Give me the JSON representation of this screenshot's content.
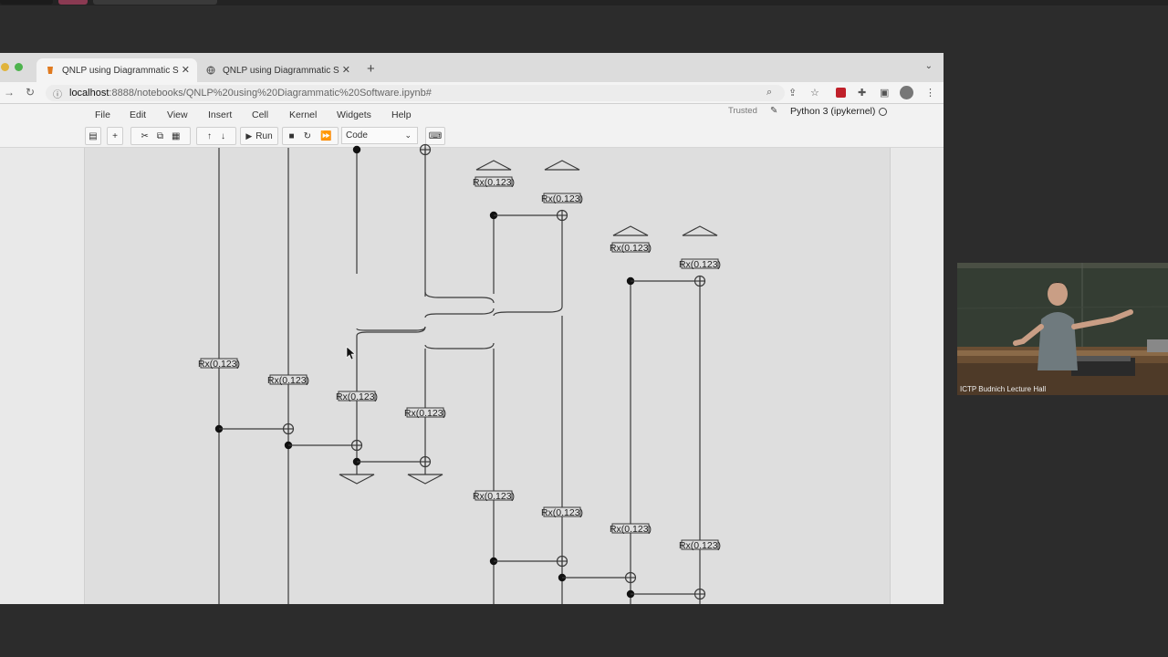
{
  "browser": {
    "tabs": [
      {
        "title": "QNLP using Diagrammatic Sof",
        "active": true,
        "icon": "jupyter-favicon"
      },
      {
        "title": "QNLP using Diagrammatic Sof",
        "active": false,
        "icon": "globe-icon"
      }
    ],
    "new_tab": "+",
    "url_host": "localhost",
    "url_path": ":8888/notebooks/QNLP%20using%20Diagrammatic%20Software.ipynb#"
  },
  "jupyter": {
    "menu": [
      "File",
      "Edit",
      "View",
      "Insert",
      "Cell",
      "Kernel",
      "Widgets",
      "Help"
    ],
    "trusted": "Trusted",
    "kernel": "Python 3 (ipykernel)",
    "run_label": "Run",
    "cell_type": "Code"
  },
  "diagram": {
    "gate_label": "Rx(0.123)"
  },
  "webcam": {
    "caption": "ICTP Budnich Lecture Hall"
  },
  "colors": {
    "desktop": "#2c2c2c",
    "notebook_bg": "#dedede",
    "wire": "#3a3a3a"
  }
}
